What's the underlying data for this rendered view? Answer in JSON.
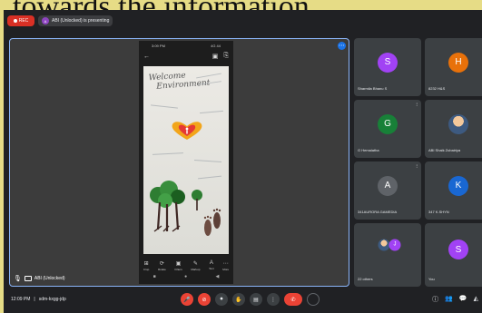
{
  "caption": "towards the information.",
  "top": {
    "rec_label": "REC",
    "presenter_initial": "A",
    "presenting_text": "ABI (Unlocked) is presenting"
  },
  "presenter": {
    "welcome_line1": "Welcome",
    "welcome_line2": "Environment",
    "status_time": "3:09 PM",
    "status_right": "4G 44",
    "tools": [
      {
        "glyph": "⊞",
        "label": "Crop"
      },
      {
        "glyph": "⟳",
        "label": "Rotate"
      },
      {
        "glyph": "▣",
        "label": "Filters"
      },
      {
        "glyph": "✎",
        "label": "Markup"
      },
      {
        "glyph": "A",
        "label": "Text"
      },
      {
        "glyph": "⋯",
        "label": "More"
      }
    ],
    "nav": [
      "■",
      "●",
      "◀"
    ],
    "name": "ABI (Unlocked)"
  },
  "participants": [
    {
      "initial": "S",
      "name": "Sharmila Bhanu S",
      "color": "#a142f4"
    },
    {
      "initial": "H",
      "name": "8232 H&S",
      "color": "#e8710a"
    },
    {
      "initial": "G",
      "name": "G Hemalatha",
      "color": "#188038"
    },
    {
      "initial": "",
      "name": "ABI Shaik Zubairiya",
      "color": "#3d5a80"
    },
    {
      "initial": "A",
      "name": "341AURORA GAMEDIA",
      "color": "#5f6368"
    },
    {
      "initial": "K",
      "name": "347 K.SHYN",
      "color": "#1967d2"
    },
    {
      "initial": "J",
      "name": "22 others",
      "color": "#a142f4"
    },
    {
      "initial": "S",
      "name": "You",
      "color": "#a142f4"
    }
  ],
  "bottom": {
    "time": "12:09 PM",
    "meeting_code": "sdm-kxgg-jdp",
    "end_glyph": "✆",
    "controls": [
      "🎤",
      "⏺",
      "✋",
      "▤",
      "⋮"
    ],
    "right": [
      "ⓘ",
      "👥",
      "💬",
      "◭"
    ]
  }
}
